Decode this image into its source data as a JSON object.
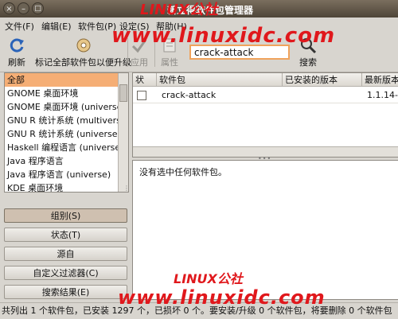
{
  "window": {
    "title": "新立得软件包管理器",
    "buttons": {
      "close": "×",
      "minimize": "–",
      "maximize": "□"
    }
  },
  "menubar": {
    "items": [
      "文件(F)",
      "编辑(E)",
      "软件包(P)",
      "设定(S)",
      "帮助(H)"
    ]
  },
  "toolbar": {
    "reload_label": "刷新",
    "mark_upgrades_label": "标记全部软件包以便升级",
    "apply_label": "应用",
    "properties_label": "属性",
    "search_value": "crack-attack",
    "search_label": "搜索"
  },
  "categories": {
    "items": [
      "全部",
      "GNOME 桌面环境",
      "GNOME 桌面环境 (universe)",
      "GNU R 统计系统 (multiverse)",
      "GNU R 统计系统 (universe)",
      "Haskell 编程语言 (universe)",
      "Java 程序语言",
      "Java 程序语言 (universe)",
      "KDE 桌面环境"
    ],
    "selected": 0
  },
  "filter_buttons": {
    "sections": "组别(S)",
    "status": "状态(T)",
    "origin": "源自",
    "custom": "自定义过滤器(C)",
    "search_results": "搜索结果(E)"
  },
  "table": {
    "headers": {
      "status": "状",
      "package": "软件包",
      "installed": "已安装的版本",
      "latest": "最新版本"
    },
    "rows": [
      {
        "package": "crack-attack",
        "installed": "",
        "latest": "1.1.14-"
      }
    ]
  },
  "detail": {
    "text": "没有选中任何软件包。"
  },
  "statusbar": {
    "text": "共列出 1 个软件包，已安装 1297 个，已损坏 0 个。要安装/升级 0 个软件包，将要删除 0 个软件包"
  },
  "watermarks": {
    "brand": "LINUX公社",
    "url": "www.linuxidc.com"
  },
  "colors": {
    "selection": "#f5ae75",
    "search_focus": "#f0a35c",
    "watermark": "#e0181c",
    "titlebar": "#5e5446"
  }
}
